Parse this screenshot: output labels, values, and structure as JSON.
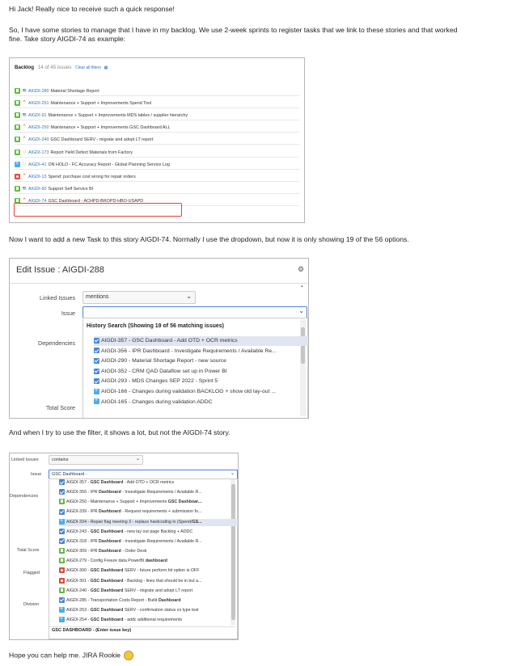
{
  "intro": {
    "greeting": "Hi Jack! Really nice to receive such a quick response!",
    "line1": "So, I have some stories to manage that I have in my backlog. We use 2-week sprints to register tasks that we link to these stories and that worked",
    "line2": "fine. Take story AIGDI-74 as example:"
  },
  "backlog": {
    "title": "Backlog",
    "count": "14 of 45 issues",
    "clear_filters": "Clear all filters",
    "items": [
      {
        "icon": "story",
        "prio": "low",
        "key": "AIGDI-280",
        "summary": "Material Shortage Report"
      },
      {
        "icon": "story",
        "prio": "high",
        "key": "AIGDI-251",
        "summary": "Maintenance + Support + Improvements Spend Tool"
      },
      {
        "icon": "story",
        "prio": "low",
        "key": "AIGDI-91",
        "summary": "Maintenance + Support + Improvements MDS tables / supplier hierarchy"
      },
      {
        "icon": "story",
        "prio": "high",
        "key": "AIGDI-250",
        "summary": "Maintenance + Support + Improvements GSC Dashboard ALL"
      },
      {
        "icon": "story",
        "prio": "high",
        "key": "AIGDI-240",
        "summary": "GSC Dashboard SERV - migrate and adopt LT report"
      },
      {
        "icon": "story",
        "prio": "med",
        "key": "AIGDI-173",
        "summary": "Report Yield Defect Materials from Factory"
      },
      {
        "icon": "sub",
        "prio": "med",
        "key": "AIGDI-41",
        "summary": "ON HOLD - FC Accuracy Report - Global Planning Service Log"
      },
      {
        "icon": "bug",
        "prio": "high",
        "key": "AIGDI-13",
        "summary": "Spend: purchase cost wrong for repair orders"
      },
      {
        "icon": "story",
        "prio": "low",
        "key": "AIGDI-90",
        "summary": "Support Self Service BI"
      },
      {
        "icon": "story",
        "prio": "high",
        "key": "AIGDI-74",
        "summary": "GSC Dashboard - ACHPD-BROPD-HBO-USAPD"
      }
    ]
  },
  "para2": "Now I want to add a new Task to this story AIGDI-74. Normally I use the dropdown, but now it is only showing 19 of the 56 options.",
  "edit_issue": {
    "title": "Edit Issue : AIGDI-288",
    "linked_label": "Linked Issues",
    "linked_value": "mentions",
    "issue_label": "Issue",
    "dependencies_label": "Dependencies",
    "total_score_label": "Total Score",
    "history_header": "History Search (Showing 19 of 56 matching issues)",
    "items": [
      {
        "icon": "check",
        "text": "AIGDI-357 - GSC Dashboard - Add OTD + OCR metrics"
      },
      {
        "icon": "check",
        "text": "AIGDI-356 - IPR Dashboard - Investigate Requirements / Available Re..."
      },
      {
        "icon": "check",
        "text": "AIGDI-290 - Material Shortage Report - new source"
      },
      {
        "icon": "check",
        "text": "AIGDI-352 - CRM QAD Dataflow set up in Power BI"
      },
      {
        "icon": "check",
        "text": "AIGDI-293 - MDS Changes SEP 2022 - Sprint 5"
      },
      {
        "icon": "sub",
        "text": "AIGDI-166 - Changes during validation BACKLOG + show old lay-out ..."
      },
      {
        "icon": "sub",
        "text": "AIGDI-165 - Changes during validation ADDC"
      }
    ]
  },
  "para3": "And when I try to use the filter, it shows a lot, but not the AIGDI-74 story.",
  "filter": {
    "linked_label": "Linked Issues",
    "linked_value": "contains",
    "issue_label": "Issue",
    "issue_value": "GSC Dashboard -",
    "dependencies_label": "Dependencies",
    "total_score_label": "Total Score",
    "flagged_label": "Flagged",
    "division_label": "Division",
    "footer": "GSC DASHBOARD - (Enter issue key)",
    "items": [
      {
        "icon": "check",
        "pre": "AIGDI-357 - ",
        "bold": "GSC Dashboard",
        "post": " - Add OTD + OCR metrics"
      },
      {
        "icon": "check",
        "pre": "AIGDI-356 - IPR ",
        "bold": "Dashboard",
        "post": " - Investigate Requirements / Available R..."
      },
      {
        "icon": "story",
        "pre": "AIGDI-250 - Maintenance + Support + Improvements ",
        "bold": "GSC Dashboar...",
        "post": ""
      },
      {
        "icon": "check",
        "pre": "AIGDI-339 - IPR ",
        "bold": "Dashboard",
        "post": " - Request requirements + submission fo..."
      },
      {
        "icon": "sub",
        "pre": "AIGDI-334 - Repair flag meeting 3 - replace hardcoding in (Spend/",
        "bold": "GS...",
        "post": ""
      },
      {
        "icon": "check",
        "pre": "AIGDI-243 - ",
        "bold": "GSC Dashboard",
        "post": " - new lay out page Backlog + ADDC"
      },
      {
        "icon": "check",
        "pre": "AIGDI-318 - IPR ",
        "bold": "Dashboard",
        "post": " - Investigate Requirements / Available R..."
      },
      {
        "icon": "story",
        "pre": "AIGDI-309 - IPR ",
        "bold": "Dashboard",
        "post": " - Order Desk"
      },
      {
        "icon": "story",
        "pre": "AIGDI-279 - Config Freeze data PowerBI ",
        "bold": "dashboard",
        "post": ""
      },
      {
        "icon": "bug",
        "pre": "AIGDI-300 - ",
        "bold": "GSC Dashboard",
        "post": " SERV - future perform hit option is OFF"
      },
      {
        "icon": "bug",
        "pre": "AIGDI-301 - ",
        "bold": "GSC Dashboard",
        "post": " - Backlog - lines that should be in but a..."
      },
      {
        "icon": "story",
        "pre": "AIGDI-240 - ",
        "bold": "GSC Dashboard",
        "post": " SERV - migrate and adopt LT report"
      },
      {
        "icon": "check",
        "pre": "AIGDI-285 - Transportation Costs Report - Build ",
        "bold": "Dashboard",
        "post": ""
      },
      {
        "icon": "sub",
        "pre": "AIGDI-253 - ",
        "bold": "GSC Dashboard",
        "post": " SERV - confirmation status vs type test"
      },
      {
        "icon": "sub",
        "pre": "AIGDI-254 - ",
        "bold": "GSC Dashboard",
        "post": " - addc additional requirements"
      }
    ]
  },
  "closing": "Hope you can help me. JIRA Rookie",
  "colors": {
    "accent": "#4b86d6",
    "story": "#63ba3c",
    "bug": "#e5493a",
    "highlight": "#e8403a"
  }
}
